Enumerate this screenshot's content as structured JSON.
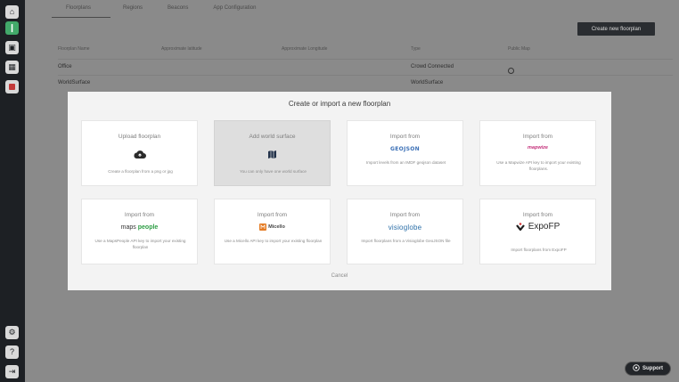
{
  "sidebar": {
    "top_items": [
      {
        "name": "home",
        "glyph": "⌂"
      },
      {
        "name": "layers",
        "glyph": "❙"
      },
      {
        "name": "book",
        "glyph": "▣"
      },
      {
        "name": "calendar",
        "glyph": "▦"
      },
      {
        "name": "report",
        "glyph": ""
      }
    ],
    "bottom_items": [
      {
        "name": "settings",
        "glyph": "⚙"
      },
      {
        "name": "help",
        "glyph": "?"
      },
      {
        "name": "logout",
        "glyph": "⇥"
      }
    ]
  },
  "tabs": [
    "Floorplans",
    "Regions",
    "Beacons",
    "App Configuration"
  ],
  "create_button": "Create new floorplan",
  "table": {
    "headers": [
      "Floorplan Name",
      "Approximate latitude",
      "Approximate Longitude",
      "Type",
      "Public Map"
    ],
    "rows": [
      {
        "name": "Office",
        "lat": "",
        "lng": "",
        "type": "Crowd Connected",
        "public": "globe"
      },
      {
        "name": "WorldSurface",
        "lat": "",
        "lng": "",
        "type": "WorldSurface",
        "public": ""
      }
    ]
  },
  "modal": {
    "title": "Create or import a new floorplan",
    "cards": [
      {
        "title": "Upload floorplan",
        "icon": "cloud-upload-icon",
        "desc": "Create a floorplan from a png or jpg"
      },
      {
        "title": "Add world surface",
        "icon": "map-icon",
        "desc": "You can only have one world surface"
      },
      {
        "title": "Import from",
        "logo": "GEOJSON",
        "desc": "Import levels from an IMDF geojson dataset"
      },
      {
        "title": "Import from",
        "logo": "mapwize",
        "desc": "Use a Mapwize API key to import your existing floorplans."
      },
      {
        "title": "Import from",
        "logo_a": "maps",
        "logo_b": "people",
        "desc": "Use a MapsPeople API key to import your existing floorplan"
      },
      {
        "title": "Import from",
        "logo": "Micello",
        "desc": "Use a Micello API key to import your existing floorplan"
      },
      {
        "title": "Import from",
        "logo": "visioglobe",
        "desc": "Import floorplans from a Visioglobe GeoJSON file"
      },
      {
        "title": "Import from",
        "logo": "ExpoFP",
        "desc": "Import floorplans from ExpoFP"
      }
    ],
    "cancel": "Cancel"
  },
  "support_label": "Support",
  "colors": {
    "accent": "#42a96a",
    "sidebar": "#1d2024",
    "modal": "#f3f3f3"
  }
}
